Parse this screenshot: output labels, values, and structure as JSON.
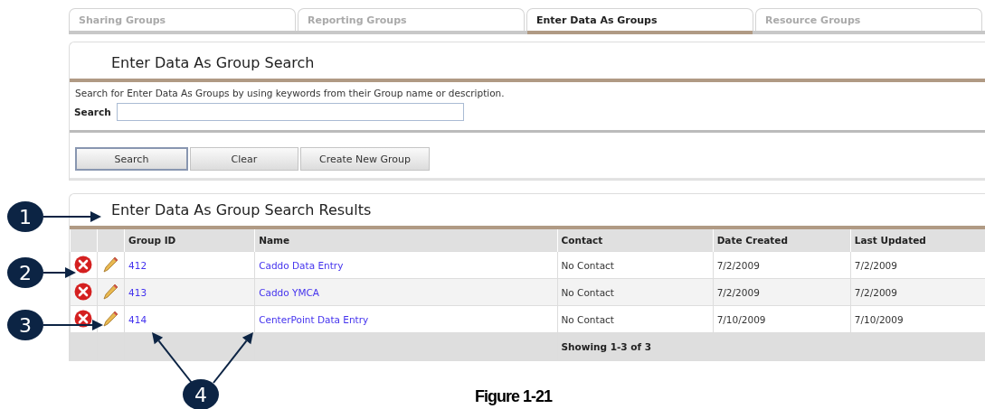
{
  "tabs": [
    {
      "label": "Sharing Groups",
      "selected": false
    },
    {
      "label": "Reporting Groups",
      "selected": false
    },
    {
      "label": "Enter Data As Groups",
      "selected": true
    },
    {
      "label": "Resource Groups",
      "selected": false
    }
  ],
  "search_panel": {
    "title": "Enter Data As Group Search",
    "description": "Search for Enter Data As Groups by using keywords from their Group name or description.",
    "search_label": "Search",
    "buttons": [
      {
        "label": "Search",
        "selected": true
      },
      {
        "label": "Clear",
        "selected": false
      },
      {
        "label": "Create New Group",
        "selected": false
      }
    ]
  },
  "results_panel": {
    "title": "Enter Data As Group Search Results",
    "table": {
      "columns": [
        "Group ID",
        "Name",
        "Contact",
        "Date Created",
        "Last Updated"
      ],
      "rows": [
        [
          "412",
          "Caddo Data Entry",
          "No Contact",
          "7/2/2009",
          "7/2/2009"
        ],
        [
          "413",
          "Caddo YMCA",
          "No Contact",
          "7/2/2009",
          "7/2/2009"
        ],
        [
          "414",
          "CenterPoint Data Entry",
          "No Contact",
          "7/10/2009",
          "7/10/2009"
        ]
      ],
      "footer": "Showing 1-3 of 3"
    }
  },
  "callouts": [
    "1",
    "2",
    "3",
    "4"
  ],
  "caption": "Figure 1-21"
}
